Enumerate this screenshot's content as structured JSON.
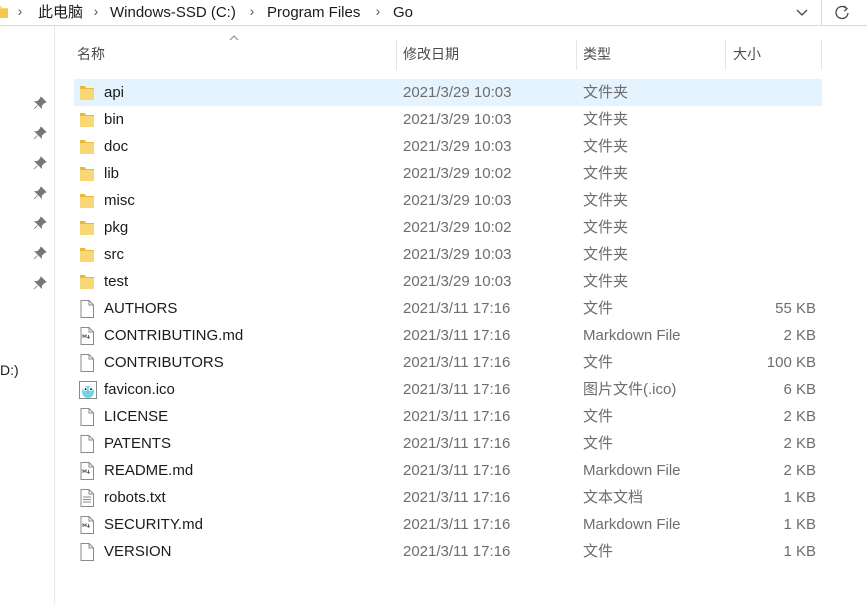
{
  "address": {
    "crumbs": [
      "此电脑",
      "Windows-SSD (C:)",
      "Program Files",
      "Go"
    ]
  },
  "nav": {
    "drive_fragment": "D:)"
  },
  "columns": {
    "name": "名称",
    "modified": "修改日期",
    "type": "类型",
    "size": "大小"
  },
  "files": [
    {
      "name": "api",
      "modified": "2021/3/29 10:03",
      "type": "文件夹",
      "size": "",
      "icon": "folder-icon"
    },
    {
      "name": "bin",
      "modified": "2021/3/29 10:03",
      "type": "文件夹",
      "size": "",
      "icon": "folder-icon"
    },
    {
      "name": "doc",
      "modified": "2021/3/29 10:03",
      "type": "文件夹",
      "size": "",
      "icon": "folder-icon"
    },
    {
      "name": "lib",
      "modified": "2021/3/29 10:02",
      "type": "文件夹",
      "size": "",
      "icon": "folder-icon"
    },
    {
      "name": "misc",
      "modified": "2021/3/29 10:03",
      "type": "文件夹",
      "size": "",
      "icon": "folder-icon"
    },
    {
      "name": "pkg",
      "modified": "2021/3/29 10:02",
      "type": "文件夹",
      "size": "",
      "icon": "folder-icon"
    },
    {
      "name": "src",
      "modified": "2021/3/29 10:03",
      "type": "文件夹",
      "size": "",
      "icon": "folder-icon"
    },
    {
      "name": "test",
      "modified": "2021/3/29 10:03",
      "type": "文件夹",
      "size": "",
      "icon": "folder-icon"
    },
    {
      "name": "AUTHORS",
      "modified": "2021/3/11 17:16",
      "type": "文件",
      "size": "55 KB",
      "icon": "file-icon"
    },
    {
      "name": "CONTRIBUTING.md",
      "modified": "2021/3/11 17:16",
      "type": "Markdown File",
      "size": "2 KB",
      "icon": "markdown-file-icon"
    },
    {
      "name": "CONTRIBUTORS",
      "modified": "2021/3/11 17:16",
      "type": "文件",
      "size": "100 KB",
      "icon": "file-icon"
    },
    {
      "name": "favicon.ico",
      "modified": "2021/3/11 17:16",
      "type": "图片文件(.ico)",
      "size": "6 KB",
      "icon": "gopher-image-icon"
    },
    {
      "name": "LICENSE",
      "modified": "2021/3/11 17:16",
      "type": "文件",
      "size": "2 KB",
      "icon": "file-icon"
    },
    {
      "name": "PATENTS",
      "modified": "2021/3/11 17:16",
      "type": "文件",
      "size": "2 KB",
      "icon": "file-icon"
    },
    {
      "name": "README.md",
      "modified": "2021/3/11 17:16",
      "type": "Markdown File",
      "size": "2 KB",
      "icon": "markdown-file-icon"
    },
    {
      "name": "robots.txt",
      "modified": "2021/3/11 17:16",
      "type": "文本文档",
      "size": "1 KB",
      "icon": "text-file-icon"
    },
    {
      "name": "SECURITY.md",
      "modified": "2021/3/11 17:16",
      "type": "Markdown File",
      "size": "1 KB",
      "icon": "markdown-file-icon"
    },
    {
      "name": "VERSION",
      "modified": "2021/3/11 17:16",
      "type": "文件",
      "size": "1 KB",
      "icon": "file-icon"
    }
  ],
  "selected_index": 0,
  "colors": {
    "selection": "#e5f3ff",
    "folder": "#f8d775",
    "secondary_text": "#6d6d6d"
  }
}
